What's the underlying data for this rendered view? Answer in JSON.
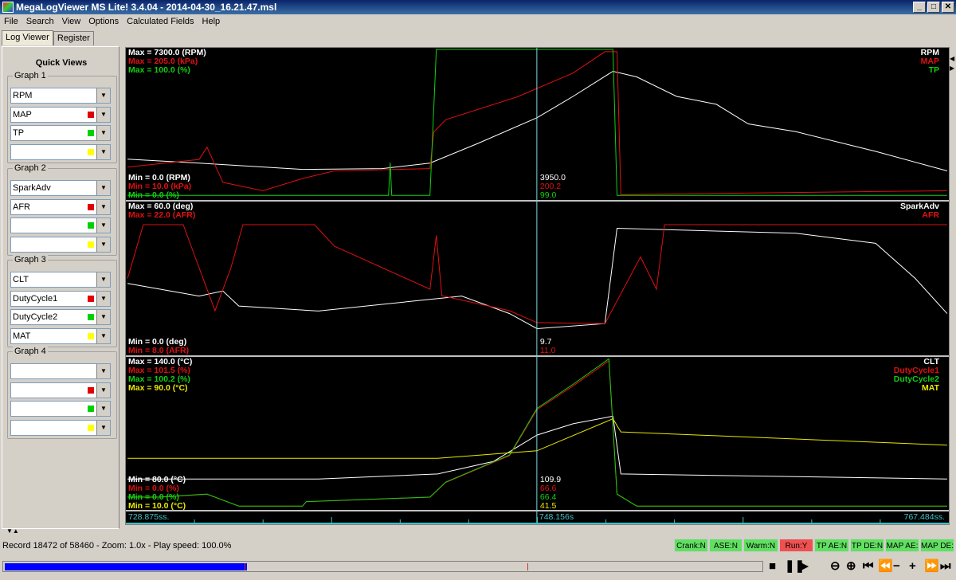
{
  "window": {
    "title": "MegaLogViewer MS Lite! 3.4.04 - 2014-04-30_16.21.47.msl",
    "buttons": [
      "_",
      "□",
      "✕"
    ]
  },
  "menu": [
    "File",
    "Search",
    "View",
    "Options",
    "Calculated Fields",
    "Help"
  ],
  "tabs": [
    {
      "label": "Log Viewer",
      "active": true
    },
    {
      "label": "Register",
      "active": false
    }
  ],
  "quick_views": {
    "title": "Quick Views",
    "groups": [
      {
        "label": "Graph 1",
        "fields": [
          "RPM",
          "MAP",
          "TP",
          ""
        ]
      },
      {
        "label": "Graph 2",
        "fields": [
          "SparkAdv",
          "AFR",
          "",
          ""
        ]
      },
      {
        "label": "Graph 3",
        "fields": [
          "CLT",
          "DutyCycle1",
          "DutyCycle2",
          "MAT"
        ]
      },
      {
        "label": "Graph 4",
        "fields": [
          "",
          "",
          "",
          ""
        ]
      }
    ],
    "slot_colors": [
      "",
      "#e00000",
      "#00d000",
      "#ffff00"
    ]
  },
  "colors": {
    "white": "#ffffff",
    "red": "#e01010",
    "green": "#10d010",
    "yellow": "#e8e800",
    "cursor": "#7fd8e0",
    "axis": "#40c0c8"
  },
  "chart_data": [
    {
      "type": "line",
      "name": "Graph 1",
      "series": [
        {
          "name": "RPM",
          "color": "white",
          "max_label": "Max = 7300.0 (RPM)",
          "min_label": "Min = 0.0 (RPM)",
          "range": [
            0,
            7300
          ],
          "cursor_value": "3950.0",
          "points": [
            [
              728.88,
              1921
            ],
            [
              732.25,
              1729
            ],
            [
              737.12,
              1422
            ],
            [
              740.87,
              1460
            ],
            [
              743.12,
              1729
            ],
            [
              745.37,
              2690
            ],
            [
              748.16,
              3950
            ],
            [
              749.86,
              4995
            ],
            [
              751.74,
              6225
            ],
            [
              752.86,
              5955
            ],
            [
              754.74,
              4995
            ],
            [
              756.61,
              4610
            ],
            [
              758.11,
              3650
            ],
            [
              760.36,
              3266
            ],
            [
              764.11,
              2305
            ],
            [
              767.48,
              1345
            ]
          ]
        },
        {
          "name": "MAP",
          "color": "red",
          "max_label": "Max = 205.0 (kPa)",
          "min_label": "Min = 10.0 (kPa)",
          "range": [
            10,
            205
          ],
          "cursor_value": "200.2",
          "points": [
            [
              728.88,
              51
            ],
            [
              732.25,
              61
            ],
            [
              732.62,
              77
            ],
            [
              733.37,
              31
            ],
            [
              735.25,
              20
            ],
            [
              737.12,
              36
            ],
            [
              738.62,
              46
            ],
            [
              743.12,
              49
            ],
            [
              743.3,
              97
            ],
            [
              743.87,
              113
            ],
            [
              747.24,
              143
            ],
            [
              749.86,
              174
            ],
            [
              751.36,
              202
            ],
            [
              751.93,
              202
            ],
            [
              752.11,
              15
            ],
            [
              767.48,
              20
            ]
          ]
        },
        {
          "name": "TP",
          "color": "green",
          "max_label": "Max = 100.0 (%)",
          "min_label": "Min = 0.0 (%)",
          "range": [
            0,
            100
          ],
          "cursor_value": "99.0",
          "points": [
            [
              728.88,
              2
            ],
            [
              741.17,
              2
            ],
            [
              741.25,
              24
            ],
            [
              741.32,
              2
            ],
            [
              743.12,
              2
            ],
            [
              743.42,
              100
            ],
            [
              751.74,
              100
            ],
            [
              751.93,
              2
            ],
            [
              767.48,
              2
            ]
          ]
        }
      ]
    },
    {
      "type": "line",
      "name": "Graph 2",
      "series": [
        {
          "name": "SparkAdv",
          "color": "white",
          "max_label": "Max = 60.0 (deg)",
          "min_label": "Min = 0.0 (deg)",
          "range": [
            0,
            60
          ],
          "cursor_value": "9.7",
          "points": [
            [
              728.88,
              28
            ],
            [
              732.25,
              23
            ],
            [
              733.37,
              25
            ],
            [
              734.12,
              19
            ],
            [
              737.87,
              17
            ],
            [
              743.49,
              22
            ],
            [
              744.62,
              23
            ],
            [
              746.87,
              16
            ],
            [
              748.16,
              10
            ],
            [
              751.36,
              12
            ],
            [
              751.93,
              50
            ],
            [
              760.36,
              48
            ],
            [
              764.11,
              44
            ],
            [
              765.98,
              30
            ],
            [
              767.48,
              16
            ]
          ]
        },
        {
          "name": "AFR",
          "color": "red",
          "max_label": "Max = 22.0 (AFR)",
          "min_label": "Min = 8.0 (AFR)",
          "range": [
            8,
            22
          ],
          "cursor_value": "11.0",
          "points": [
            [
              728.88,
              15
            ],
            [
              729.62,
              20
            ],
            [
              731.5,
              20
            ],
            [
              732.06,
              17
            ],
            [
              733.0,
              12
            ],
            [
              733.75,
              16
            ],
            [
              734.31,
              20
            ],
            [
              737.68,
              20
            ],
            [
              738.62,
              18
            ],
            [
              743.12,
              14
            ],
            [
              743.42,
              19
            ],
            [
              743.68,
              13.4
            ],
            [
              746.87,
              12
            ],
            [
              748.16,
              10.9
            ],
            [
              751.36,
              10.8
            ],
            [
              753.04,
              17
            ],
            [
              753.79,
              14
            ],
            [
              754.17,
              20
            ],
            [
              767.48,
              20
            ]
          ]
        }
      ]
    },
    {
      "type": "line",
      "name": "Graph 3",
      "series": [
        {
          "name": "CLT",
          "color": "white",
          "max_label": "Max = 140.0 (°C)",
          "min_label": "Min = 80.0 (°C)",
          "range": [
            80,
            140
          ],
          "cursor_value": "109.9",
          "points": [
            [
              728.88,
              92
            ],
            [
              737.87,
              92
            ],
            [
              743.49,
              94
            ],
            [
              746.12,
              99
            ],
            [
              748.16,
              109.5
            ],
            [
              749.86,
              114
            ],
            [
              751.74,
              117
            ],
            [
              752.11,
              94
            ],
            [
              767.48,
              92
            ]
          ]
        },
        {
          "name": "DutyCycle1",
          "color": "red",
          "max_label": "Max = 101.5 (%)",
          "min_label": "Min = 0.0 (%)",
          "range": [
            0,
            101.5
          ],
          "cursor_value": "66.6",
          "points": [
            [
              728.88,
              8
            ],
            [
              730.37,
              8
            ],
            [
              732.62,
              10
            ],
            [
              734.12,
              2
            ],
            [
              737.12,
              2
            ],
            [
              737.3,
              5
            ],
            [
              743.12,
              8
            ],
            [
              743.87,
              18
            ],
            [
              746.87,
              36
            ],
            [
              748.16,
              67
            ],
            [
              749.86,
              83
            ],
            [
              751.55,
              100
            ],
            [
              751.93,
              10
            ],
            [
              752.86,
              2
            ],
            [
              767.48,
              2
            ]
          ]
        },
        {
          "name": "DutyCycle2",
          "color": "green",
          "max_label": "Max = 100.2 (%)",
          "min_label": "Min = 0.0 (%)",
          "range": [
            0,
            100.2
          ],
          "cursor_value": "66.4",
          "points": [
            [
              728.88,
              8
            ],
            [
              730.37,
              8
            ],
            [
              732.62,
              10
            ],
            [
              734.12,
              2
            ],
            [
              737.12,
              2
            ],
            [
              737.3,
              5
            ],
            [
              743.12,
              8
            ],
            [
              743.87,
              18
            ],
            [
              746.87,
              36
            ],
            [
              748.16,
              67
            ],
            [
              749.86,
              83
            ],
            [
              751.55,
              100
            ],
            [
              751.93,
              10
            ],
            [
              752.86,
              2
            ],
            [
              767.48,
              2
            ]
          ]
        },
        {
          "name": "MAT",
          "color": "yellow",
          "max_label": "Max = 90.0 (°C)",
          "min_label": "Min = 10.0 (°C)",
          "range": [
            10,
            90
          ],
          "cursor_value": "41.5",
          "points": [
            [
              728.88,
              37
            ],
            [
              743.49,
              37
            ],
            [
              748.16,
              41
            ],
            [
              751.74,
              58
            ],
            [
              752.11,
              51
            ],
            [
              767.48,
              44
            ]
          ]
        }
      ]
    }
  ],
  "time_axis": {
    "start": "728.875ss.",
    "cursor": "748.156s",
    "end": "767.484ss.",
    "range": [
      728.875,
      767.484
    ],
    "cursor_time": 748.156
  },
  "status": {
    "text": "Record 18472 of 58460 - Zoom: 1.0x - Play speed: 100.0%",
    "record": 18472,
    "total": 58460
  },
  "indicators": [
    {
      "label": "Crank:N",
      "on": false
    },
    {
      "label": "ASE:N",
      "on": false
    },
    {
      "label": "Warm:N",
      "on": false
    },
    {
      "label": "Run:Y",
      "on": true
    },
    {
      "label": "TP AE:N",
      "on": false
    },
    {
      "label": "TP DE:N",
      "on": false
    },
    {
      "label": "MAP AE:",
      "on": false
    },
    {
      "label": "MAP DE:",
      "on": false
    }
  ],
  "playback": {
    "loaded_fraction": 0.32,
    "position_fraction": 0.316,
    "marker_fraction": 0.69
  },
  "controls": [
    {
      "name": "stop-icon",
      "glyph": "■"
    },
    {
      "name": "pause-icon",
      "glyph": "❚❚"
    },
    {
      "name": "play-icon",
      "glyph": "▶"
    },
    {
      "name": "zoom-out-icon",
      "glyph": "⊖"
    },
    {
      "name": "zoom-in-icon",
      "glyph": "⊕"
    },
    {
      "name": "skip-start-icon",
      "glyph": "⏮"
    },
    {
      "name": "rewind-icon",
      "glyph": "⏪"
    },
    {
      "name": "slower-icon",
      "glyph": "−"
    },
    {
      "name": "faster-icon",
      "glyph": "+"
    },
    {
      "name": "fast-forward-icon",
      "glyph": "⏩"
    },
    {
      "name": "skip-end-icon",
      "glyph": "⏭"
    }
  ]
}
